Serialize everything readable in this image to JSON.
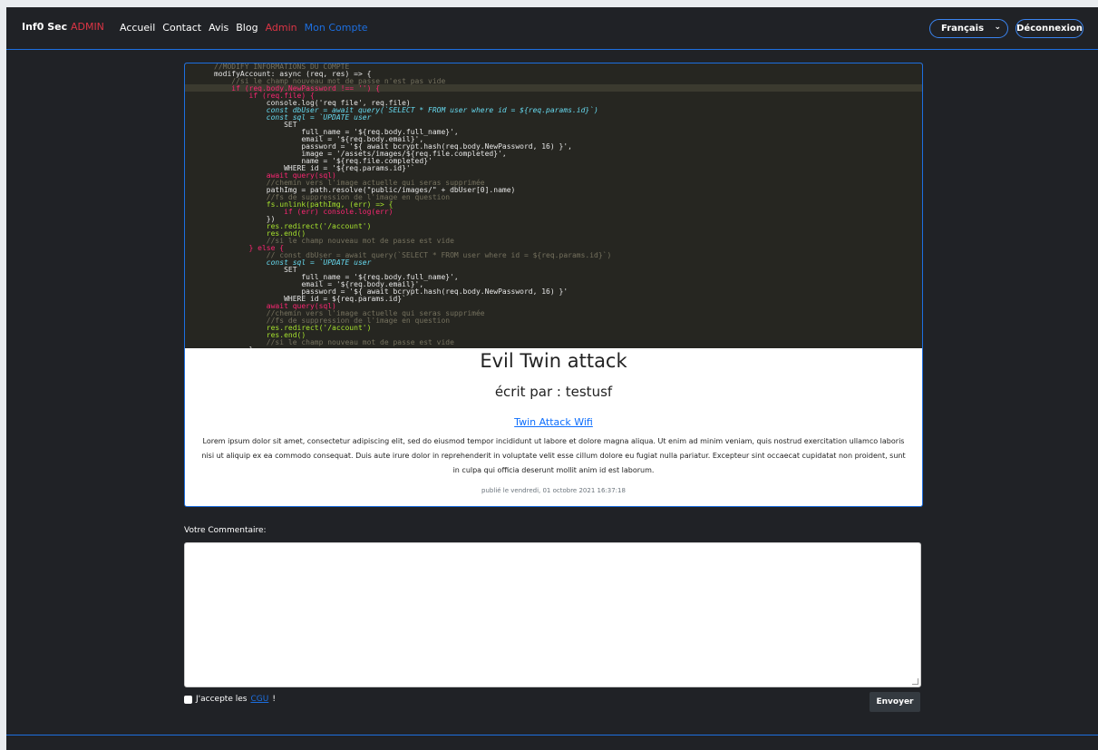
{
  "navbar": {
    "brand": "Inf0 Sec",
    "brand_admin": "ADMIN",
    "links": [
      "Accueil",
      "Contact",
      "Avis",
      "Blog"
    ],
    "admin_link": "Admin",
    "account_link": "Mon Compte",
    "language": "Français",
    "logout": "Déconnexion"
  },
  "article": {
    "image_code": [
      "//MODIFY INFORMATIONS DU COMPTE",
      "modifyAccount: async (req, res) => {",
      "    //si le champ nouveau mot de passe n'est pas vide",
      "    if (req.body.NewPassword !== '') {",
      "        if (req.file) {",
      "            console.log('req file', req.file)",
      "            const dbUser = await query(`SELECT * FROM user where id = ${req.params.id}`)",
      "            const sql = `UPDATE user",
      "                SET",
      "                    full_name = '${req.body.full_name}',",
      "                    email = '${req.body.email}',",
      "                    password = '${ await bcrypt.hash(req.body.NewPassword, 16) }',",
      "                    image = '/assets/images/${req.file.completed}',",
      "                    name = '${req.file.completed}'",
      "                WHERE id = '${req.params.id}'`",
      "            await query(sql)",
      "            //chemin vers l'image actuelle qui seras supprimée",
      "            pathImg = path.resolve(\"public/images/\" + dbUser[0].name)",
      "            //fs de suppression de l'image en question",
      "            fs.unlink(pathImg, (err) => {",
      "                if (err) console.log(err)",
      "            })",
      "            res.redirect('/account')",
      "            res.end()",
      "            //si le champ nouveau mot de passe est vide",
      "        } else {",
      "            // const dbUser = await query(`SELECT * FROM user where id = ${req.params.id}`)",
      "            const sql = `UPDATE user",
      "                SET",
      "                    full_name = '${req.body.full_name}',",
      "                    email = '${req.body.email}',",
      "                    password = '${ await bcrypt.hash(req.body.NewPassword, 16) }'",
      "                WHERE id = ${req.params.id}`",
      "            await query(sql)",
      "            //chemin vers l'image actuelle qui seras supprimée",
      "            //fs de suppression de l'image en question",
      "            res.redirect('/account')",
      "            res.end()",
      "            //si le champ nouveau mot de passe est vide",
      "        }"
    ],
    "title": "Evil Twin attack",
    "author": "écrit par : testusf",
    "link": "Twin Attack Wifi",
    "body": "Lorem ipsum dolor sit amet, consectetur adipiscing elit, sed do eiusmod tempor incididunt ut labore et dolore magna aliqua. Ut enim ad minim veniam, quis nostrud exercitation ullamco laboris nisi ut aliquip ex ea commodo consequat. Duis aute irure dolor in reprehenderit in voluptate velit esse cillum dolore eu fugiat nulla pariatur. Excepteur sint occaecat cupidatat non proident, sunt in culpa qui officia deserunt mollit anim id est laborum.",
    "date": "publié le vendredi, 01 octobre 2021 16:37:18"
  },
  "comment": {
    "label": "Votre Commentaire:",
    "value": "",
    "cgu_prefix": "J'accepte les",
    "cgu_link": "CGU",
    "cgu_suffix": "!",
    "submit": "Envoyer"
  }
}
